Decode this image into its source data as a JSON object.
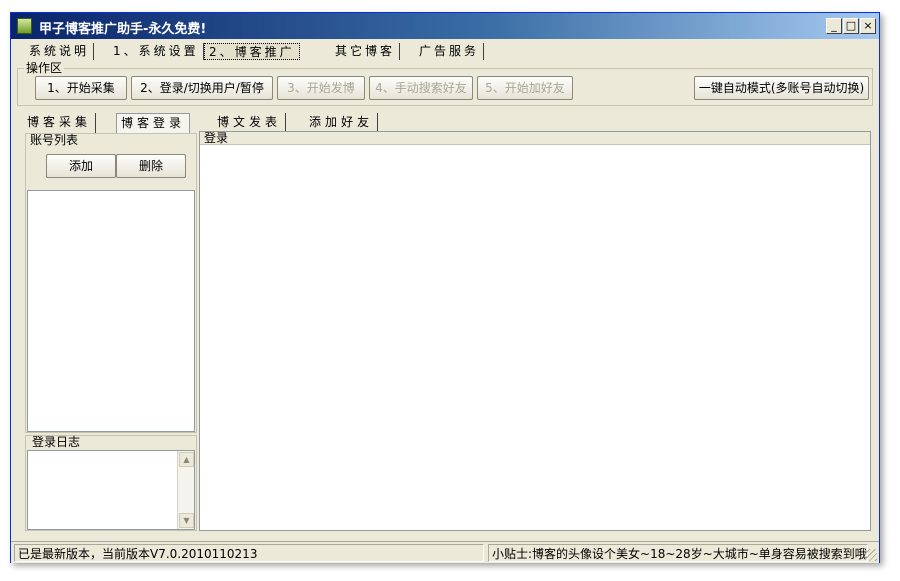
{
  "window": {
    "title": "甲子博客推广助手-永久免费!",
    "controls": {
      "minimize": "_",
      "maximize": "□",
      "close": "×"
    }
  },
  "menu": {
    "items": [
      "系统说明",
      "1、系统设置",
      "2、博客推广",
      "其它博客",
      "广告服务"
    ],
    "active_index": 2
  },
  "operation_group": {
    "label": "操作区",
    "buttons": [
      {
        "label": "1、开始采集",
        "enabled": true
      },
      {
        "label": "2、登录/切换用户/暂停",
        "enabled": true
      },
      {
        "label": "3、开始发博",
        "enabled": false
      },
      {
        "label": "4、手动搜索好友",
        "enabled": false
      },
      {
        "label": "5、开始加好友",
        "enabled": false
      }
    ],
    "auto_button": "一键自动模式(多账号自动切换)"
  },
  "tabs": {
    "items": [
      "博客采集",
      "博客登录",
      "博文发表",
      "添加好友"
    ],
    "active_index": 1
  },
  "account_list": {
    "header": "账号列表",
    "add_button": "添加",
    "delete_button": "删除"
  },
  "login_panel": {
    "header": "登录"
  },
  "login_log": {
    "header": "登录日志"
  },
  "statusbar": {
    "version_text": "已是最新版本，当前版本V7.0.2010110213",
    "tip_text": "小贴士:博客的头像设个美女~18~28岁~大城市~单身容易被搜索到哦"
  }
}
